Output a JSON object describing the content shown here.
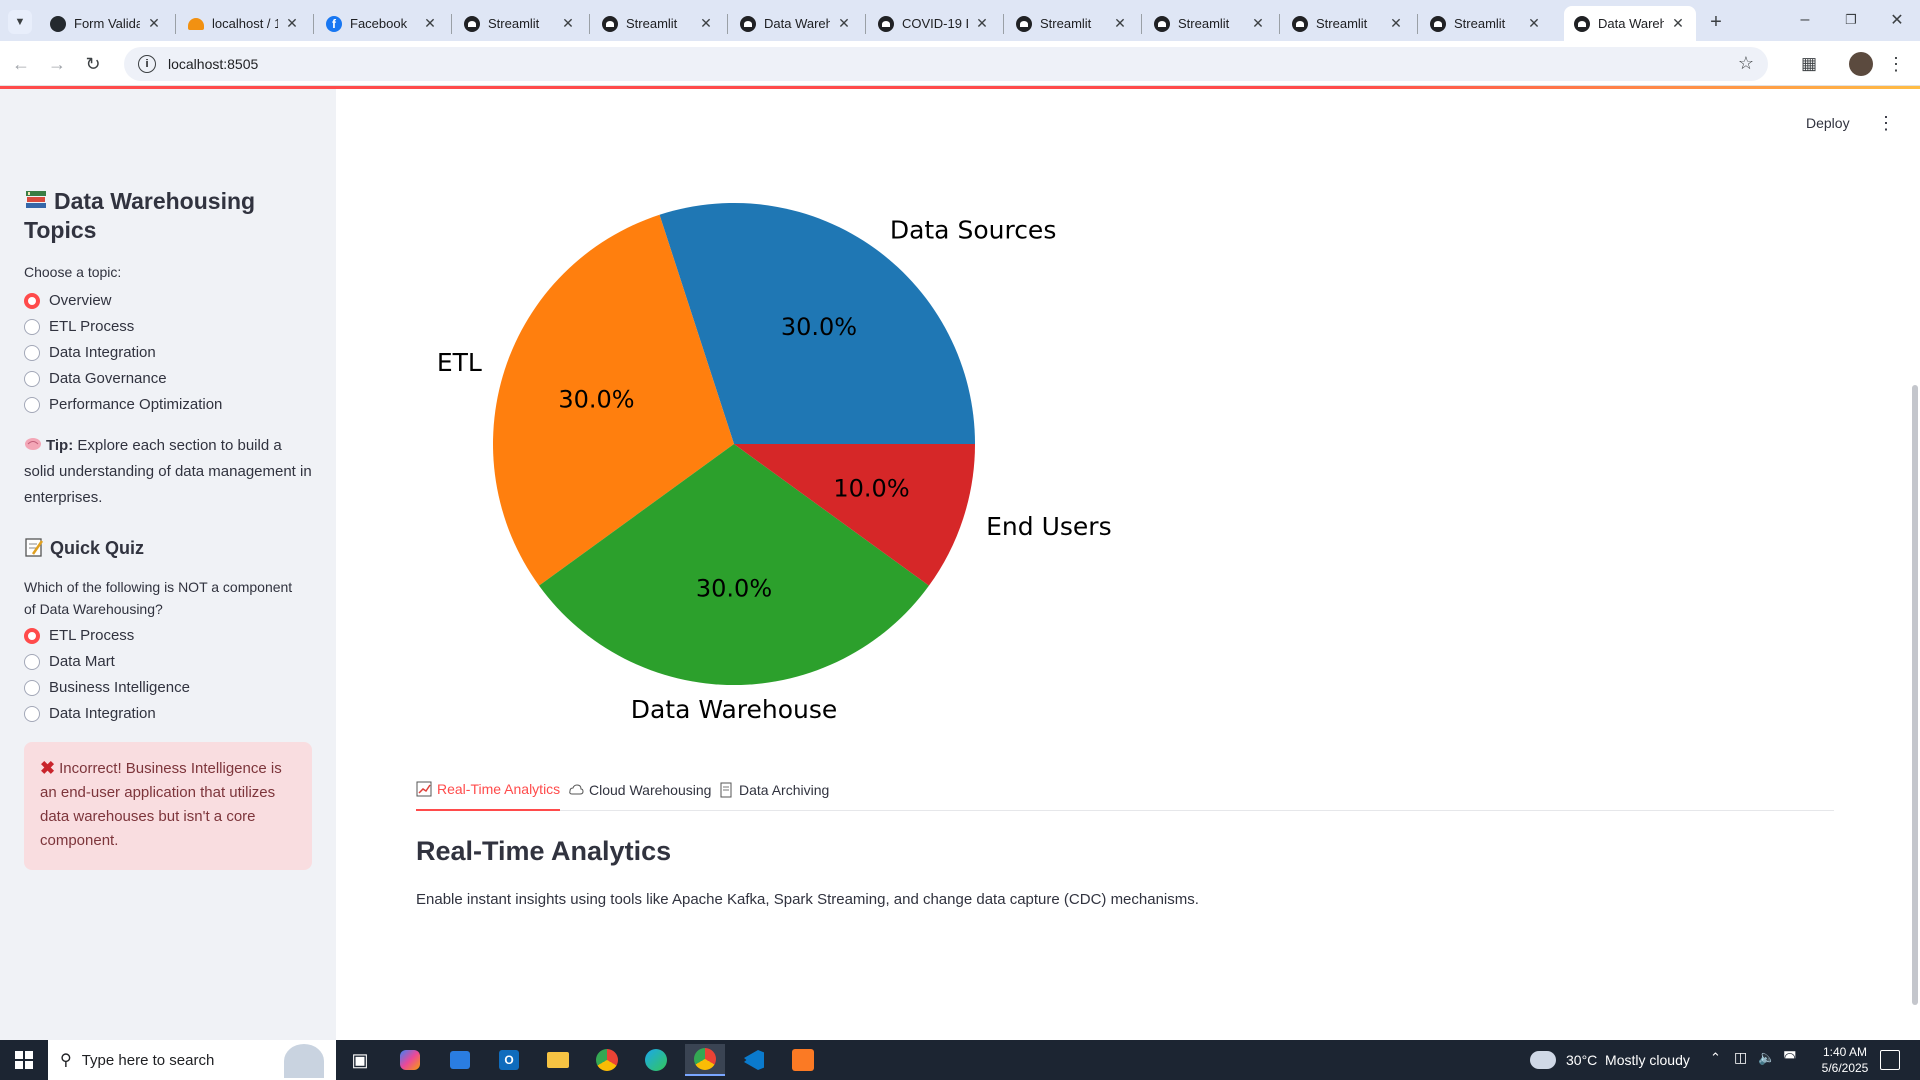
{
  "browser": {
    "tabs": [
      {
        "label": "Form Validat",
        "icon": "github-icon"
      },
      {
        "label": "localhost / 1",
        "icon": "phpmyadmin-icon"
      },
      {
        "label": "Facebook",
        "icon": "facebook-icon"
      },
      {
        "label": "Streamlit",
        "icon": "streamlit-icon"
      },
      {
        "label": "Streamlit",
        "icon": "streamlit-icon"
      },
      {
        "label": "Data Wareho",
        "icon": "streamlit-icon"
      },
      {
        "label": "COVID-19 Da",
        "icon": "streamlit-icon"
      },
      {
        "label": "Streamlit",
        "icon": "streamlit-icon"
      },
      {
        "label": "Streamlit",
        "icon": "streamlit-icon"
      },
      {
        "label": "Streamlit",
        "icon": "streamlit-icon"
      },
      {
        "label": "Streamlit",
        "icon": "streamlit-icon"
      },
      {
        "label": "Data Wareho",
        "icon": "streamlit-icon"
      }
    ],
    "active_tab": 11,
    "url": "localhost:8505"
  },
  "app": {
    "deploy_label": "Deploy"
  },
  "sidebar": {
    "title": "Data Warehousing Topics",
    "title_icon": "books-emoji",
    "choose_label": "Choose a topic:",
    "topics": [
      "Overview",
      "ETL Process",
      "Data Integration",
      "Data Governance",
      "Performance Optimization"
    ],
    "selected_topic": 0,
    "tip_label": "Tip:",
    "tip_text": "Explore each section to build a solid understanding of data management in enterprises.",
    "quiz_title": "Quick Quiz",
    "quiz_question": "Which of the following is NOT a component of Data Warehousing?",
    "quiz_options": [
      "ETL Process",
      "Data Mart",
      "Business Intelligence",
      "Data Integration"
    ],
    "quiz_selected": 0,
    "error_text": "Incorrect! Business Intelligence is an end-user application that utilizes data warehouses but isn't a core component.",
    "colors": {
      "accent": "#ff4b4b",
      "error_bg": "#f9dde0",
      "error_text": "#7d353b"
    }
  },
  "chart_data": {
    "type": "pie",
    "categories": [
      "Data Sources",
      "ETL",
      "Data Warehouse",
      "End Users"
    ],
    "values": [
      30.0,
      30.0,
      30.0,
      10.0
    ],
    "labels": [
      "30.0%",
      "30.0%",
      "30.0%",
      "10.0%"
    ],
    "colors": [
      "#1f77b4",
      "#ff7f0e",
      "#2ca02c",
      "#d62728"
    ]
  },
  "tabs": [
    {
      "label": "Real-Time Analytics",
      "icon": "chart-icon"
    },
    {
      "label": "Cloud Warehousing",
      "icon": "cloud-icon"
    },
    {
      "label": "Data Archiving",
      "icon": "archive-icon"
    }
  ],
  "active_content": {
    "heading": "Real-Time Analytics",
    "body": "Enable instant insights using tools like Apache Kafka, Spark Streaming, and change data capture (CDC) mechanisms."
  },
  "taskbar": {
    "search_placeholder": "Type here to search",
    "weather": "30°C  Mostly cloudy",
    "time": "1:40 AM",
    "date": "5/6/2025"
  }
}
